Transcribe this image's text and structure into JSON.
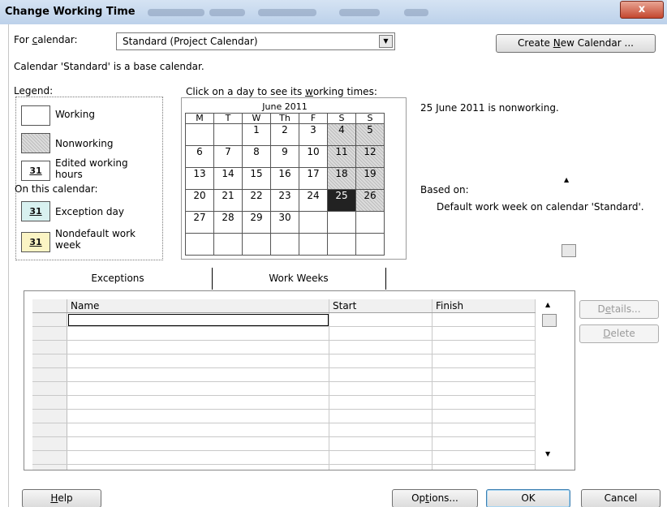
{
  "window": {
    "title": "Change Working Time",
    "close_glyph": "x"
  },
  "calendar_selector": {
    "label_pre": "For ",
    "label_u": "c",
    "label_post": "alendar:",
    "value": "Standard (Project Calendar)"
  },
  "create_button": {
    "pre": "Create ",
    "u": "N",
    "post": "ew Calendar ..."
  },
  "base_info": "Calendar 'Standard' is a base calendar.",
  "legend": {
    "title": "Legend:",
    "working": "Working",
    "nonworking": "Nonworking",
    "edited_line1": "Edited working",
    "edited_line2": "hours",
    "on_this_calendar": "On this calendar:",
    "exception": "Exception day",
    "nondefault_line1": "Nondefault work",
    "nondefault_line2": "week",
    "day_number": "31"
  },
  "calendar": {
    "prompt_pre": "Click on a day to see its ",
    "prompt_u": "w",
    "prompt_post": "orking times:",
    "month": "June 2011",
    "weekdays": [
      "M",
      "T",
      "W",
      "Th",
      "F",
      "S",
      "S"
    ],
    "weeks": [
      [
        "",
        "",
        "1",
        "2",
        "3",
        "4",
        "5"
      ],
      [
        "6",
        "7",
        "8",
        "9",
        "10",
        "11",
        "12"
      ],
      [
        "13",
        "14",
        "15",
        "16",
        "17",
        "18",
        "19"
      ],
      [
        "20",
        "21",
        "22",
        "23",
        "24",
        "25",
        "26"
      ],
      [
        "27",
        "28",
        "29",
        "30",
        "",
        "",
        ""
      ],
      [
        "",
        "",
        "",
        "",
        "",
        "",
        ""
      ]
    ],
    "selected_day": "25"
  },
  "day_status": "25 June 2011 is nonworking.",
  "based_on": {
    "label": "Based on:",
    "text": "Default work week on calendar 'Standard'."
  },
  "tabs": {
    "exceptions": "Exceptions",
    "work_weeks": "Work Weeks"
  },
  "grid": {
    "columns": [
      "Name",
      "Start",
      "Finish"
    ],
    "empty_rows": 12
  },
  "side_buttons": {
    "details_pre": "D",
    "details_u": "e",
    "details_post": "tails...",
    "delete_u": "D",
    "delete_post": "elete"
  },
  "footer": {
    "help_u": "H",
    "help_post": "elp",
    "options_pre": "Op",
    "options_u": "t",
    "options_post": "ions...",
    "ok": "OK",
    "cancel": "Cancel"
  },
  "colors": {
    "titlebar": "#c9dbf0",
    "selected_day": "#222222",
    "exception_bg": "#d8f1f0",
    "nondefault_bg": "#fbf4c4"
  },
  "icons": [
    "close-icon",
    "dropdown-arrow-icon",
    "scroll-up-icon",
    "scroll-down-icon"
  ]
}
